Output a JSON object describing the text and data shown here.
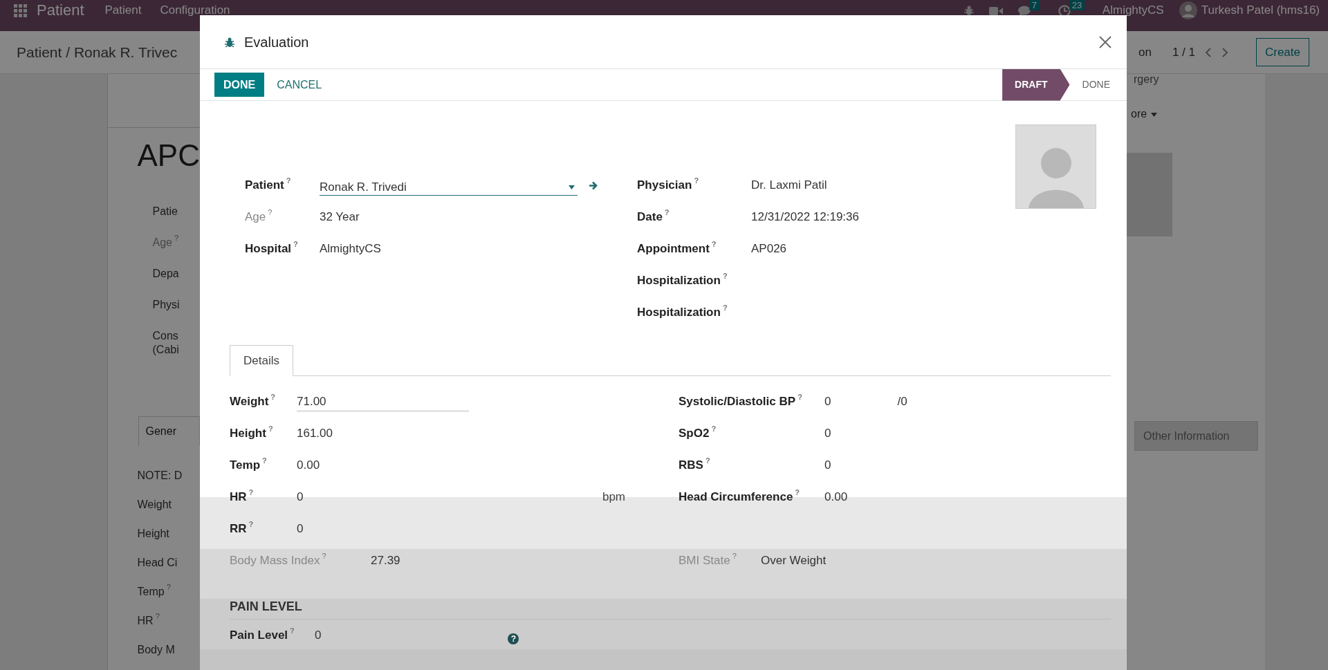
{
  "app_bar": {
    "app_name": "Patient",
    "menus": [
      "Patient",
      "Configuration"
    ],
    "chat_count": "7",
    "activity_count": "23",
    "company": "AlmightyCS",
    "user": "Turkesh Patel (hms16)"
  },
  "background_form": {
    "breadcrumb": "Patient / Ronak R. Trivec",
    "action_menu": "on",
    "pager": "1 / 1",
    "create_button": "Create",
    "menu_item": "rgery",
    "more_button": "ore",
    "title": "APC",
    "fields": [
      {
        "label": "Patie"
      },
      {
        "label": "Age",
        "help": "?",
        "readonly": true
      },
      {
        "label": "Depa"
      },
      {
        "label": "Physi"
      },
      {
        "label": "Cons (Cabi"
      }
    ],
    "tabs": [
      {
        "label": "Gener",
        "selected": true
      },
      {
        "label": "Other Information",
        "selected": false
      }
    ],
    "note": "NOTE: D",
    "vitals": [
      {
        "label": "Weight"
      },
      {
        "label": "Height"
      },
      {
        "label": "Head Ci"
      },
      {
        "label": "Temp",
        "help": "?"
      },
      {
        "label": "HR",
        "help": "?"
      },
      {
        "label": "Body M"
      }
    ]
  },
  "dialog": {
    "title": "Evaluation",
    "buttons": [
      {
        "label": "DONE",
        "kind": "primary"
      },
      {
        "label": "CANCEL",
        "kind": "link"
      }
    ],
    "stages": [
      {
        "label": "DRAFT",
        "selected": true
      },
      {
        "label": "DONE",
        "selected": false
      }
    ],
    "left_fields": [
      {
        "label": "Patient",
        "help": "?",
        "value": "Ronak R. Trivedi",
        "kind": "many2one",
        "readonly": false
      },
      {
        "label": "Age",
        "help": "?",
        "value": "32 Year",
        "kind": "text",
        "readonly": true
      },
      {
        "label": "Hospital",
        "help": "?",
        "value": "AlmightyCS",
        "kind": "text",
        "readonly": false
      }
    ],
    "right_fields": [
      {
        "label": "Physician",
        "help": "?",
        "value": "Dr. Laxmi Patil",
        "kind": "text",
        "readonly": false
      },
      {
        "label": "Date",
        "help": "?",
        "value": "12/31/2022 12:19:36",
        "kind": "text",
        "readonly": false
      },
      {
        "label": "Appointment",
        "help": "?",
        "value": "AP026",
        "kind": "text",
        "readonly": false
      },
      {
        "label": "Hospitalization",
        "help": "?",
        "readonly": false
      },
      {
        "label": "Hospitalization",
        "help": "?",
        "readonly": false
      }
    ],
    "tabs": [
      {
        "label": "Details",
        "selected": true
      }
    ],
    "details_left": [
      {
        "label": "Weight",
        "help": "?",
        "value": "71.00",
        "kind": "input",
        "readonly": false
      },
      {
        "label": "Height",
        "help": "?",
        "value": "161.00",
        "kind": "text",
        "readonly": false
      },
      {
        "label": "Temp",
        "help": "?",
        "value": "0.00",
        "kind": "text",
        "readonly": false
      },
      {
        "label": "HR",
        "help": "?",
        "value": "0",
        "unit": "bpm",
        "kind": "text",
        "readonly": false
      },
      {
        "label": "RR",
        "help": "?",
        "value": "0",
        "kind": "text",
        "readonly": false
      }
    ],
    "details_right": [
      {
        "label": "Systolic/Diastolic BP",
        "help": "?",
        "value": "0",
        "suffix": "/0",
        "kind": "text",
        "readonly": false
      },
      {
        "label": "SpO2",
        "help": "?",
        "value": "0",
        "kind": "text",
        "readonly": false
      },
      {
        "label": "RBS",
        "help": "?",
        "value": "0",
        "kind": "text",
        "readonly": false
      },
      {
        "label": "Head Circumference",
        "help": "?",
        "value": "0.00",
        "kind": "text",
        "readonly": false
      }
    ],
    "bmi": [
      {
        "label": "Body Mass Index",
        "help": "?",
        "value": "27.39",
        "kind": "text",
        "readonly": true
      },
      {
        "label": "BMI State",
        "help": "?",
        "value": "Over Weight",
        "kind": "text",
        "readonly": true
      }
    ],
    "pain_section": {
      "title": "PAIN LEVEL",
      "fields": [
        {
          "label": "Pain Level",
          "help": "?",
          "value": "0",
          "kind": "text",
          "readonly": false,
          "help_icon": "?"
        }
      ]
    }
  }
}
